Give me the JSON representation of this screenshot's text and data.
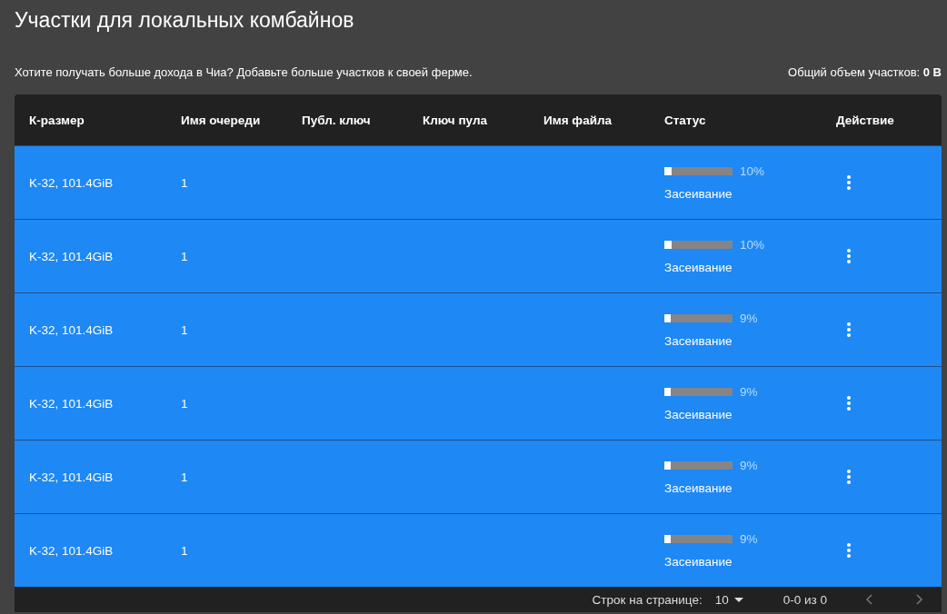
{
  "title": "Участки для локальных комбайнов",
  "intro": "Хотите получать больше дохода в Чиа? Добавьте больше участков к своей ферме.",
  "total": "Общий объем участков: **0 B**",
  "table": {
    "columns": [
      "К-размер",
      "Имя очереди",
      "Публ. ключ",
      "Ключ пула",
      "Имя файла",
      "Статус",
      "Действие"
    ],
    "rows": [
      {
        "size": "K-32, 101.4GiB",
        "queue": "1",
        "level": 0.1,
        "percent": "10%",
        "status": "Засеивание",
        "selected": true
      },
      {
        "size": "K-32, 101.4GiB",
        "queue": "1",
        "level": 0.1,
        "percent": "10%",
        "status": "Засеивание",
        "selected": true
      },
      {
        "size": "K-32, 101.4GiB",
        "queue": "1",
        "level": 0.09,
        "percent": "9%",
        "status": "Засеивание",
        "selected": true
      },
      {
        "size": "K-32, 101.4GiB",
        "queue": "1",
        "level": 0.09,
        "percent": "9%",
        "status": "Засеивание",
        "selected": true
      },
      {
        "size": "K-32, 101.4GiB",
        "queue": "1",
        "level": 0.09,
        "percent": "9%",
        "status": "Засеивание",
        "selected": true
      },
      {
        "size": "K-32, 101.4GiB",
        "queue": "1",
        "level": 0.09,
        "percent": "9%",
        "status": "Засеивание",
        "selected": true
      }
    ]
  },
  "pagination": {
    "rows_label": "Строк на странице:",
    "rows_per_page": "10",
    "range": "0-0 из 0"
  }
}
